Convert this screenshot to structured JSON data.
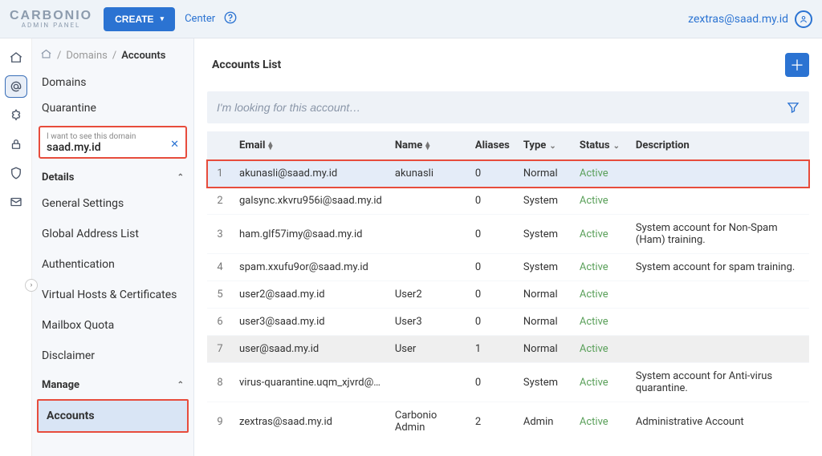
{
  "header": {
    "logo_main": "CARBONIO",
    "logo_sub": "ADMIN PANEL",
    "create_label": "CREATE",
    "center_label": "Center",
    "user_email": "zextras@saad.my.id"
  },
  "breadcrumb": {
    "home_icon": "home",
    "mid": "Domains",
    "current": "Accounts"
  },
  "sidebar": {
    "top_links": [
      "Domains",
      "Quarantine"
    ],
    "domain_filter": {
      "label": "I want to see this domain",
      "value": "saad.my.id"
    },
    "details_header": "Details",
    "details_items": [
      "General Settings",
      "Global Address List",
      "Authentication",
      "Virtual Hosts & Certificates",
      "Mailbox Quota",
      "Disclaimer"
    ],
    "manage_header": "Manage",
    "accounts_label": "Accounts"
  },
  "main": {
    "title": "Accounts List",
    "search_placeholder": "I'm looking for this account…",
    "columns": {
      "email": "Email",
      "name": "Name",
      "aliases": "Aliases",
      "type": "Type",
      "status": "Status",
      "description": "Description"
    },
    "rows": [
      {
        "idx": "1",
        "email": "akunasli@saad.my.id",
        "name": "akunasli",
        "aliases": "0",
        "type": "Normal",
        "status": "Active",
        "description": "",
        "highlight": true
      },
      {
        "idx": "2",
        "email": "galsync.xkvru956i@saad.my.id",
        "name": "",
        "aliases": "0",
        "type": "System",
        "status": "Active",
        "description": ""
      },
      {
        "idx": "3",
        "email": "ham.glf57imy@saad.my.id",
        "name": "",
        "aliases": "0",
        "type": "System",
        "status": "Active",
        "description": "System account for Non-Spam (Ham) training."
      },
      {
        "idx": "4",
        "email": "spam.xxufu9or@saad.my.id",
        "name": "",
        "aliases": "0",
        "type": "System",
        "status": "Active",
        "description": "System account for spam training."
      },
      {
        "idx": "5",
        "email": "user2@saad.my.id",
        "name": "User2",
        "aliases": "0",
        "type": "Normal",
        "status": "Active",
        "description": ""
      },
      {
        "idx": "6",
        "email": "user3@saad.my.id",
        "name": "User3",
        "aliases": "0",
        "type": "Normal",
        "status": "Active",
        "description": ""
      },
      {
        "idx": "7",
        "email": "user@saad.my.id",
        "name": "User",
        "aliases": "1",
        "type": "Normal",
        "status": "Active",
        "description": "",
        "gray": true
      },
      {
        "idx": "8",
        "email": "virus-quarantine.uqm_xjvrd@…",
        "name": "",
        "aliases": "0",
        "type": "System",
        "status": "Active",
        "description": "System account for Anti-virus quarantine."
      },
      {
        "idx": "9",
        "email": "zextras@saad.my.id",
        "name": "Carbonio Admin",
        "aliases": "2",
        "type": "Admin",
        "status": "Active",
        "description": "Administrative Account"
      }
    ]
  }
}
